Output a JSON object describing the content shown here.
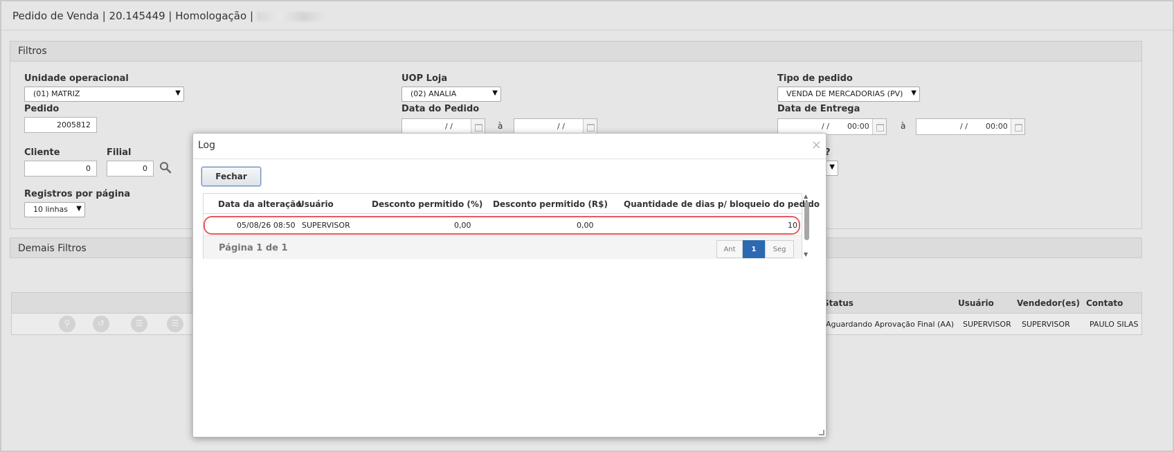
{
  "page": {
    "title": "Pedido de Venda | 20.145449 | Homologação |"
  },
  "filters": {
    "title": "Filtros",
    "unidade_label": "Unidade operacional",
    "unidade_value": "(01) MATRIZ",
    "uop_label": "UOP Loja",
    "uop_value": "(02) ANALIA",
    "tipo_label": "Tipo de pedido",
    "tipo_value": "VENDA DE MERCADORIAS (PV)",
    "pedido_label": "Pedido",
    "pedido_value": "2005812",
    "data_pedido_label": "Data do Pedido",
    "data_pedido_from": "/ /",
    "data_pedido_to": "/ /",
    "data_entrega_label": "Data de Entrega",
    "data_entrega_from": "/ /",
    "data_entrega_from_time": "00:00",
    "data_entrega_to": "/ /",
    "data_entrega_to_time": "00:00",
    "range_sep": "à",
    "cliente_label": "Cliente",
    "cliente_value": "0",
    "filial_label": "Filial",
    "filial_value": "0",
    "hidden_label_tail": "?",
    "registros_label": "Registros por página",
    "registros_value": "10 linhas"
  },
  "demais": {
    "title": "Demais Filtros"
  },
  "grid": {
    "columns": {
      "status": "Status",
      "usuario": "Usuário",
      "vendedores": "Vendedor(es)",
      "contato": "Contato"
    },
    "row": {
      "status": "Aguardando Aprovação Final (AA)",
      "usuario": "SUPERVISOR",
      "vendedor": "SUPERVISOR",
      "contato": "PAULO SILAS"
    }
  },
  "modal": {
    "title": "Log",
    "close": "×",
    "fechar": "Fechar",
    "columns": {
      "data": "Data da alteração",
      "usuario": "Usuário",
      "desc_pct": "Desconto permitido (%)",
      "desc_rs": "Desconto permitido (R$)",
      "dias": "Quantidade de dias p/ bloqueio do pedido"
    },
    "row": {
      "data": "05/08/26 08:50",
      "usuario": "SUPERVISOR",
      "desc_pct": "0,00",
      "desc_rs": "0,00",
      "dias": "10"
    },
    "pagination": {
      "text": "Página 1 de 1",
      "prev": "Ant",
      "current": "1",
      "next": "Seg"
    }
  },
  "icons": [
    "search-icon",
    "chevron-down-icon",
    "calendar-icon",
    "close-icon",
    "view-icon",
    "history-icon",
    "list-icon",
    "menu-icon"
  ]
}
